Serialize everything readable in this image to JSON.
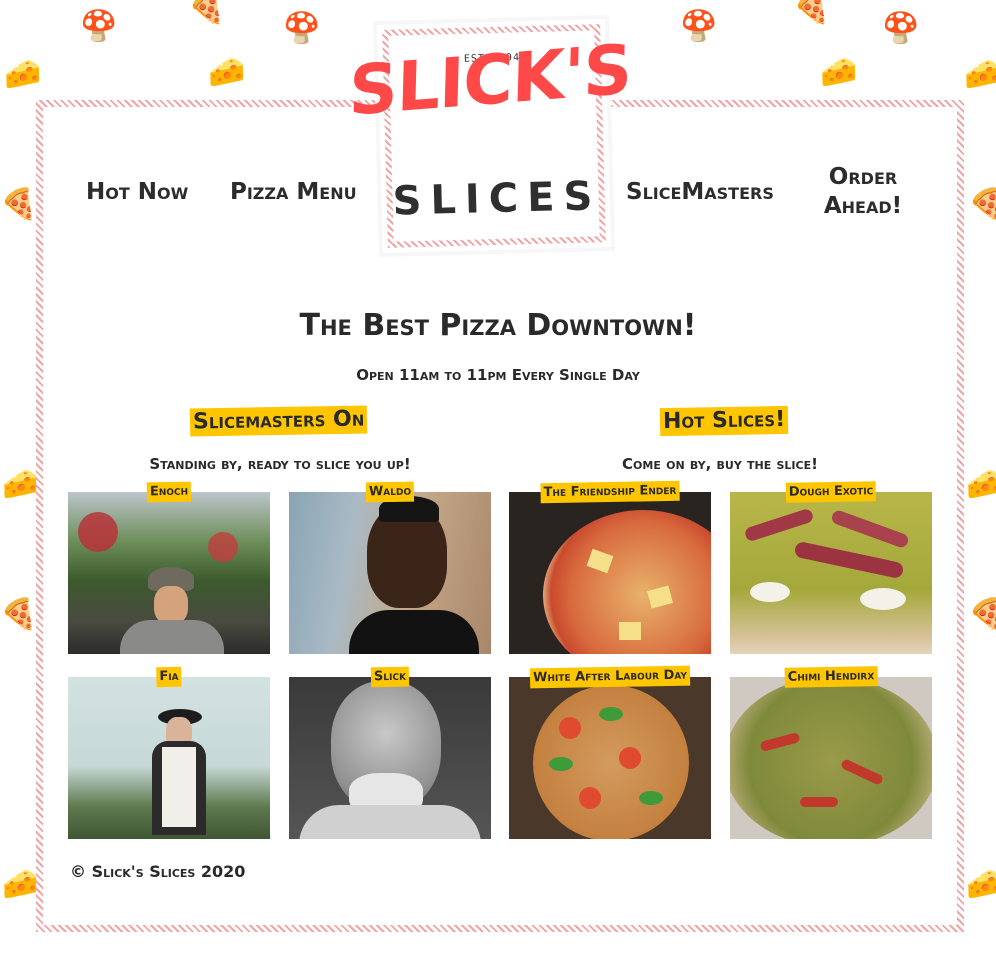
{
  "logo": {
    "est": "EST 1994",
    "name": "SLICK'S",
    "sub": "SLICES"
  },
  "nav": [
    {
      "label": "Hot Now"
    },
    {
      "label": "Pizza Menu"
    },
    {
      "label": "SliceMasters"
    },
    {
      "label": "Order Ahead!"
    }
  ],
  "headline": "The Best Pizza Downtown!",
  "hours": "Open 11am to 11pm Every Single Day",
  "slicemasters": {
    "title": "Slicemasters On",
    "subtitle": "Standing by, ready to slice you up!",
    "people": [
      {
        "name": "Enoch"
      },
      {
        "name": "Waldo"
      },
      {
        "name": "Fia"
      },
      {
        "name": "Slick"
      }
    ]
  },
  "hot_slices": {
    "title": "Hot Slices!",
    "subtitle": "Come on by, buy the slice!",
    "pizzas": [
      {
        "name": "The Friendship Ender"
      },
      {
        "name": "Dough Exotic"
      },
      {
        "name": "White After Labour Day"
      },
      {
        "name": "Chimi Hendirx"
      }
    ]
  },
  "footer": {
    "copyright_symbol": "©",
    "text": "Slick's Slices 2020"
  },
  "colors": {
    "accent": "#ff4949",
    "highlight": "#ffc600",
    "stripe": "#f1a4a4",
    "text": "#2a2a2a"
  }
}
